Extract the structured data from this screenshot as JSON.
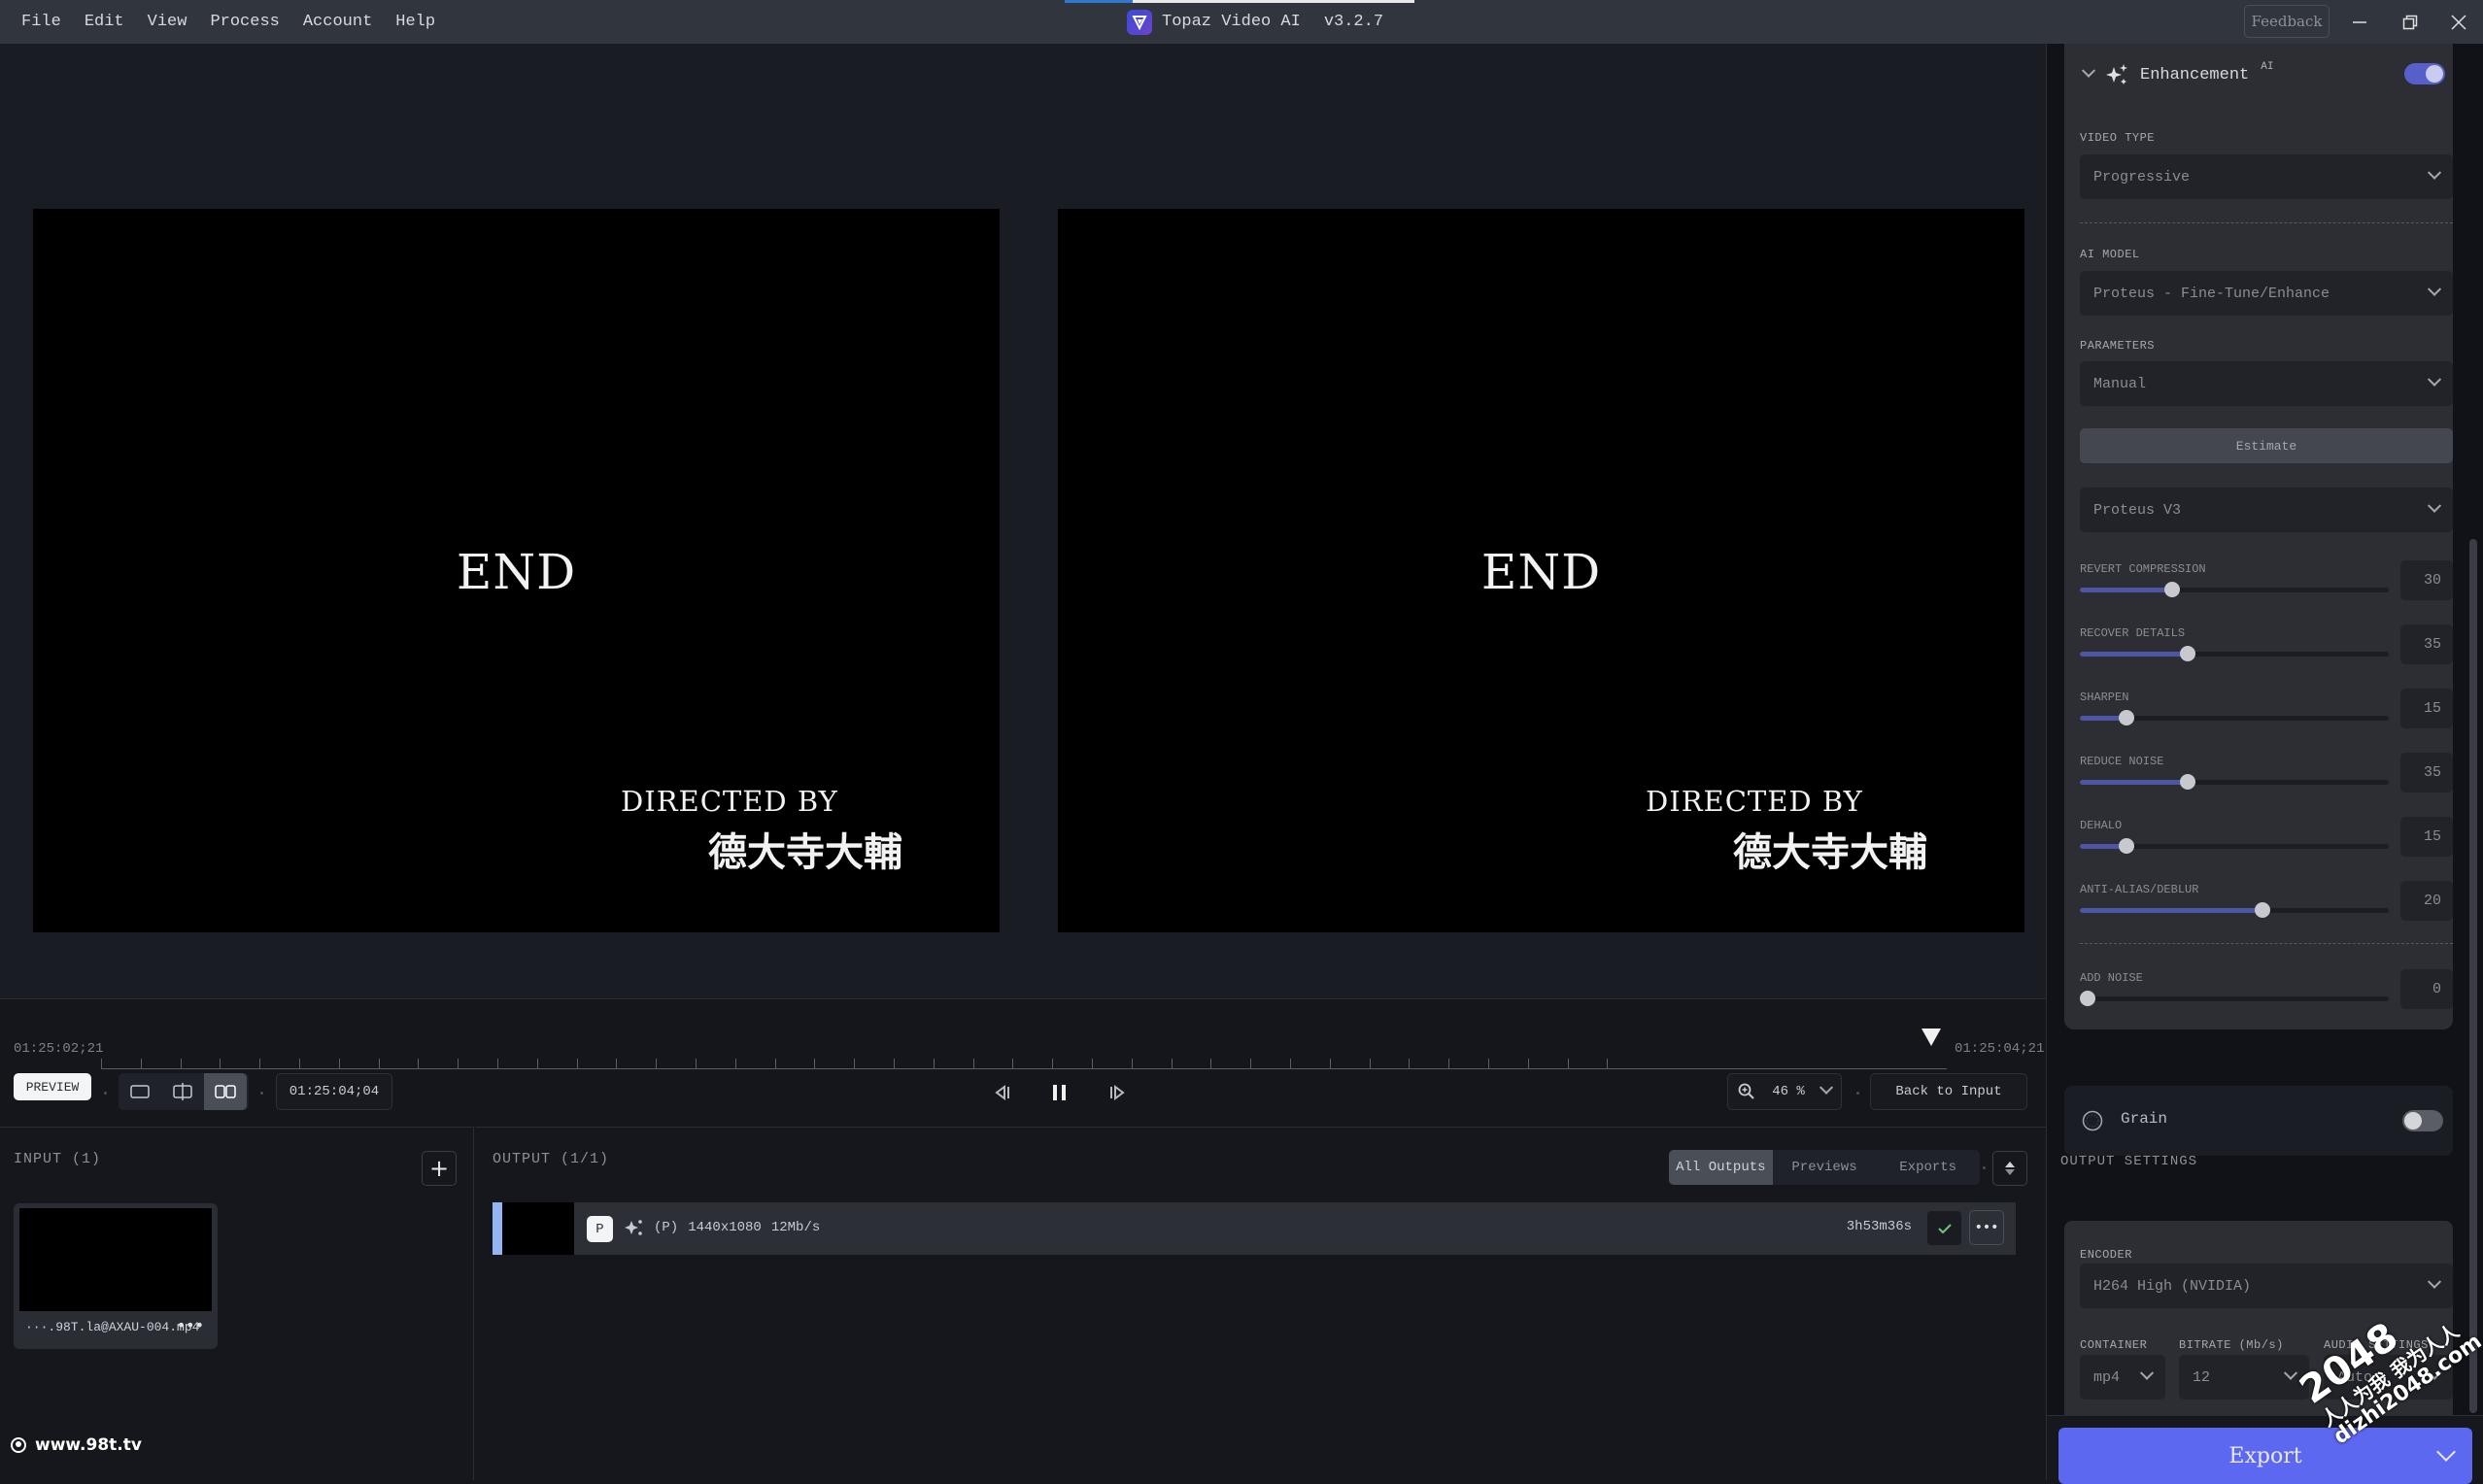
{
  "menu": [
    "File",
    "Edit",
    "View",
    "Process",
    "Account",
    "Help"
  ],
  "app": {
    "title": "Topaz Video AI",
    "version": "v3.2.7",
    "feedback_label": "Feedback"
  },
  "window_controls": {
    "minimize": "minimize-icon",
    "restore": "restore-icon",
    "close": "close-icon"
  },
  "preview": {
    "left_frame": {
      "text_end": "END",
      "text_directed": "DIRECTED BY",
      "text_name": "德大寺大輔"
    },
    "right_frame": {
      "text_end": "END",
      "text_directed": "DIRECTED BY",
      "text_name": "德大寺大輔"
    }
  },
  "timeline": {
    "start_time": "01:25:02;21",
    "end_time": "01:25:04;21",
    "current_time": "01:25:04;04",
    "playhead_fraction": 0.98
  },
  "controls": {
    "preview_label": "PREVIEW",
    "view_modes": [
      "single-view",
      "split-view",
      "side-by-side-view"
    ],
    "active_view": "side-by-side-view",
    "zoom_value": "46 %",
    "back_to_input_label": "Back to Input"
  },
  "input": {
    "title": "INPUT (1)",
    "add_label": "+",
    "file": {
      "name": "···.98T.la@AXAU-004.mp4",
      "more": "•••"
    }
  },
  "output": {
    "title": "OUTPUT (1/1)",
    "tabs": [
      {
        "label": "All Outputs",
        "active": true
      },
      {
        "label": "Previews",
        "active": false
      },
      {
        "label": "Exports",
        "active": false
      }
    ],
    "items": [
      {
        "badge": "P",
        "mode": "(P)",
        "resolution": "1440x1080",
        "bitrate": "12Mb/s",
        "duration": "3h53m36s",
        "status": "done"
      }
    ]
  },
  "watermark_site": "www.98t.tv",
  "enhancement": {
    "title": "Enhancement",
    "superscript": "AI",
    "enabled": true,
    "video_type_label": "VIDEO TYPE",
    "video_type": "Progressive",
    "ai_model_label": "AI MODEL",
    "ai_model": "Proteus - Fine-Tune/Enhance",
    "parameters_label": "PARAMETERS",
    "parameters": "Manual",
    "estimate_label": "Estimate",
    "model_version": "Proteus V3",
    "sliders": [
      {
        "label": "REVERT COMPRESSION",
        "value": 30,
        "fraction": 0.3
      },
      {
        "label": "RECOVER DETAILS",
        "value": 35,
        "fraction": 0.35
      },
      {
        "label": "SHARPEN",
        "value": 15,
        "fraction": 0.15
      },
      {
        "label": "REDUCE NOISE",
        "value": 35,
        "fraction": 0.35
      },
      {
        "label": "DEHALO",
        "value": 15,
        "fraction": 0.15
      },
      {
        "label": "ANTI-ALIAS/DEBLUR",
        "value": 20,
        "fraction": 0.59
      }
    ],
    "add_noise": {
      "label": "ADD NOISE",
      "value": 0,
      "fraction": 0
    }
  },
  "grain": {
    "label": "Grain",
    "enabled": false
  },
  "output_settings": {
    "title": "OUTPUT SETTINGS",
    "encoder_label": "ENCODER",
    "encoder": "H264 High (NVIDIA)",
    "container_label": "CONTAINER",
    "container": "mp4",
    "bitrate_label": "BITRATE (Mb/s)",
    "bitrate": "12",
    "audio_label": "AUDIO SETTINGS",
    "audio": "Auto"
  },
  "export_label": "Export",
  "overlay_watermark": {
    "line1": "2048",
    "line2": "人人为我 我为人人",
    "line3": "dizhi2048.com"
  },
  "colors": {
    "accent": "#5d68f0",
    "slider_fill": "#4d55a5",
    "toggle_on": "#5660c8",
    "check": "#6cc77a",
    "output_accent": "#93b6f3"
  }
}
